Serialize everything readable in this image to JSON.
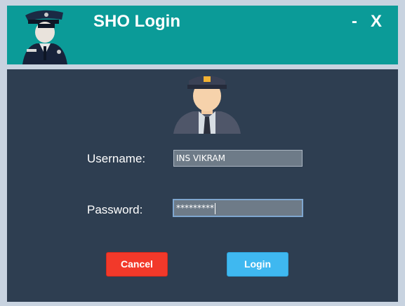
{
  "window": {
    "title": "SHO Login",
    "minimize_label": "-",
    "close_label": "X",
    "header_color": "#0b9b98"
  },
  "logo": {
    "icon": "police-officer-icon"
  },
  "avatar": {
    "icon": "police-officer-avatar-icon"
  },
  "form": {
    "username_label": "Username:",
    "username_value": "INS VIKRAM",
    "password_label": "Password:",
    "password_value": "*********"
  },
  "buttons": {
    "cancel_label": "Cancel",
    "cancel_color": "#f2392a",
    "login_label": "Login",
    "login_color": "#3fb8f0"
  }
}
